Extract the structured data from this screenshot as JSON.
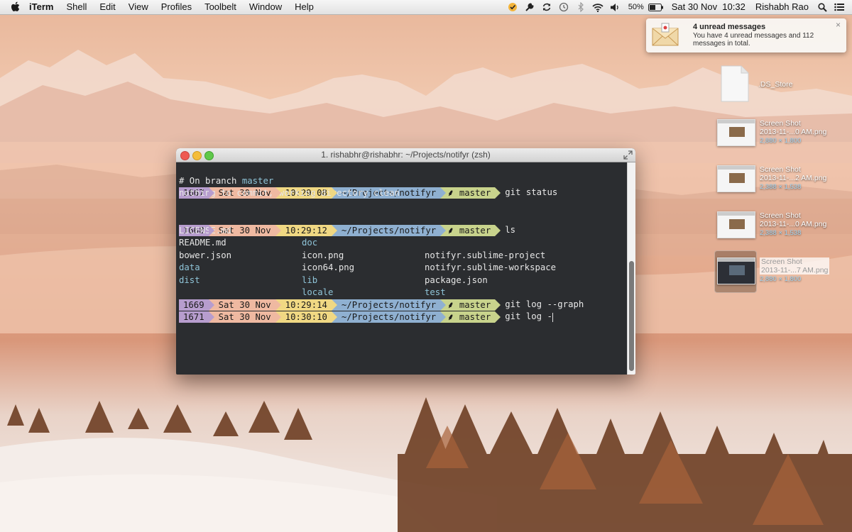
{
  "menubar": {
    "app_name": "iTerm",
    "menus": [
      "Shell",
      "Edit",
      "View",
      "Profiles",
      "Toolbelt",
      "Window",
      "Help"
    ],
    "battery": "50%",
    "clock": "Sat 30 Nov  10:32",
    "user": "Rishabh Rao",
    "icons": [
      "apple-icon",
      "check-badge-icon",
      "wrench-icon",
      "sync-icon",
      "time-machine-icon",
      "bluetooth-icon",
      "wifi-icon",
      "volume-icon",
      "battery-icon",
      "spotlight-icon",
      "notification-center-icon"
    ]
  },
  "notification": {
    "title": "4 unread messages",
    "body": "You have 4 unread messages and 112 messages in total.",
    "close": "×"
  },
  "desktop": {
    "items": [
      {
        "name": ".DS_Store",
        "dims": ""
      },
      {
        "name": "Screen Shot\n2013-11-...0 AM.png",
        "dims": "2,880 × 1,800"
      },
      {
        "name": "Screen Shot\n2013-11-...2 AM.png",
        "dims": "2,388 × 1,538"
      },
      {
        "name": "Screen Shot\n2013-11-...0 AM.png",
        "dims": "2,388 × 1,538"
      },
      {
        "name": "Screen Shot\n2013-11-...7 AM.png",
        "dims": "2,880 × 1,800"
      }
    ]
  },
  "terminal": {
    "title": "1. rishabhr@rishabhr: ~/Projects/notifyr (zsh)",
    "prompts": [
      {
        "hist": "1667",
        "date": "Sat 30 Nov",
        "time": "10:29:08",
        "dir": "~/Projects/notifyr",
        "branch": "master",
        "cmd": "git status"
      },
      {
        "hist": "1668",
        "date": "Sat 30 Nov",
        "time": "10:29:12",
        "dir": "~/Projects/notifyr",
        "branch": "master",
        "cmd": "ls"
      },
      {
        "hist": "1669",
        "date": "Sat 30 Nov",
        "time": "10:29:14",
        "dir": "~/Projects/notifyr",
        "branch": "master",
        "cmd": "git log --graph"
      },
      {
        "hist": "1671",
        "date": "Sat 30 Nov",
        "time": "10:30:10",
        "dir": "~/Projects/notifyr",
        "branch": "master",
        "cmd": "git log -"
      }
    ],
    "status_output": {
      "branch_prefix": "# On branch ",
      "branch_name": "master",
      "clean_msg": "nothing to commit, working directory clean"
    },
    "ls_output": [
      [
        "LICENSE.md",
        "doc",
        "notifyr.sublime-project"
      ],
      [
        "README.md",
        "icon.png",
        "notifyr.sublime-workspace"
      ],
      [
        "bower.json",
        "icon64.png",
        "package.json"
      ],
      [
        "data",
        "lib",
        "test"
      ],
      [
        "dist",
        "locale",
        ""
      ]
    ]
  }
}
